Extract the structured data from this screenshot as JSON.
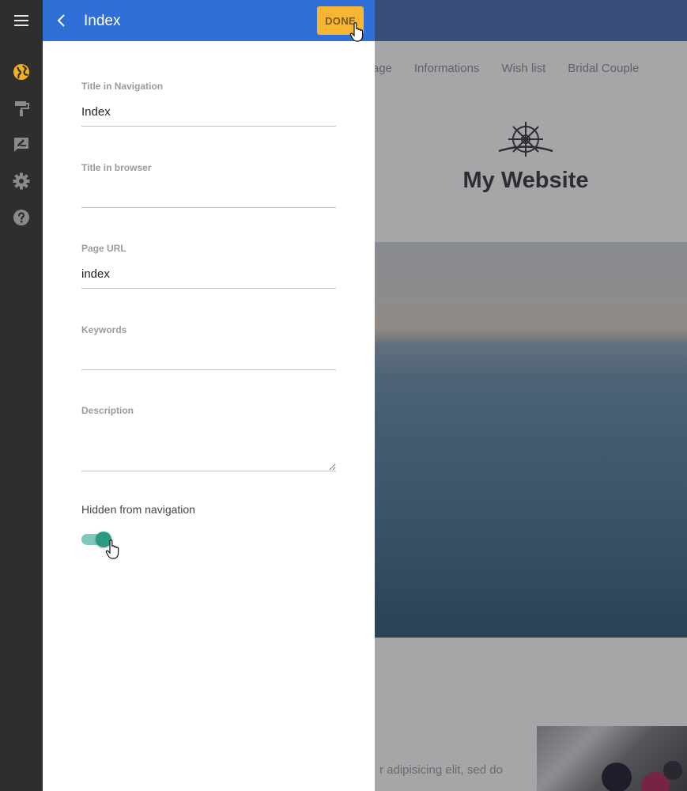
{
  "app": {
    "menu_icon": "hamburger-menu-icon",
    "rail_icons": [
      "globe-icon",
      "paint-roller-icon",
      "edit-comment-icon",
      "gear-icon",
      "help-icon"
    ],
    "colors": {
      "rail_bg": "#2e2e2e",
      "active_icon": "#f0b21e",
      "inactive_icon": "#8a8a8a",
      "header_blue": "#2f6fd6",
      "done_orange": "#f7b531",
      "toggle_teal": "#2a9a85"
    }
  },
  "panel": {
    "title": "Index",
    "done_label": "DONE",
    "fields": {
      "nav_title": {
        "label": "Title in Navigation",
        "value": "Index"
      },
      "browser_title": {
        "label": "Title in browser",
        "value": ""
      },
      "page_url": {
        "label": "Page URL",
        "value": "index"
      },
      "keywords": {
        "label": "Keywords",
        "value": ""
      },
      "description": {
        "label": "Description",
        "value": ""
      }
    },
    "hidden_toggle": {
      "label": "Hidden from navigation",
      "on": true
    }
  },
  "site": {
    "nav": [
      "ne Page",
      "Informations",
      "Wish list",
      "Bridal Couple"
    ],
    "title": "My Website",
    "body_text": "r adipisicing elit, sed do"
  }
}
